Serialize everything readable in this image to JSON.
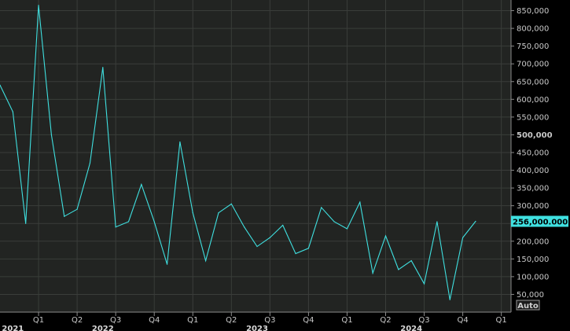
{
  "chart_data": {
    "type": "line",
    "x_unit": "month",
    "x": [
      "2021-10",
      "2021-11",
      "2021-12",
      "2022-01",
      "2022-02",
      "2022-03",
      "2022-04",
      "2022-05",
      "2022-06",
      "2022-07",
      "2022-08",
      "2022-09",
      "2022-10",
      "2022-11",
      "2022-12",
      "2023-01",
      "2023-02",
      "2023-03",
      "2023-04",
      "2023-05",
      "2023-06",
      "2023-07",
      "2023-08",
      "2023-09",
      "2023-10",
      "2023-11",
      "2023-12",
      "2024-01",
      "2024-02",
      "2024-03",
      "2024-04",
      "2024-05",
      "2024-06",
      "2024-07",
      "2024-08",
      "2024-09",
      "2024-10",
      "2024-11",
      "2024-12"
    ],
    "series": [
      {
        "color": "#3fe0e0",
        "values": [
          640000,
          565000,
          250000,
          865000,
          500000,
          270000,
          290000,
          420000,
          690000,
          240000,
          255000,
          360000,
          255000,
          135000,
          480000,
          280000,
          145000,
          280000,
          305000,
          240000,
          185000,
          210000,
          245000,
          165000,
          180000,
          295000,
          255000,
          235000,
          310000,
          110000,
          215000,
          120000,
          145000,
          80000,
          255000,
          35000,
          210000,
          256000
        ]
      }
    ],
    "ylim": [
      0,
      880000
    ],
    "yticks": [
      "50,000",
      "100,000",
      "150,000",
      "200,000",
      "250,000",
      "300,000",
      "350,000",
      "400,000",
      "450,000",
      "500,000",
      "550,000",
      "600,000",
      "650,000",
      "700,000",
      "750,000",
      "800,000",
      "850,000"
    ],
    "yticks_bold": [
      "500,000"
    ],
    "quarter_ticks": [
      {
        "label": "Q1",
        "date": "2022-01"
      },
      {
        "label": "Q2",
        "date": "2022-04"
      },
      {
        "label": "Q3",
        "date": "2022-07"
      },
      {
        "label": "Q4",
        "date": "2022-10"
      },
      {
        "label": "Q1",
        "date": "2023-01"
      },
      {
        "label": "Q2",
        "date": "2023-04"
      },
      {
        "label": "Q3",
        "date": "2023-07"
      },
      {
        "label": "Q4",
        "date": "2023-10"
      },
      {
        "label": "Q1",
        "date": "2024-01"
      },
      {
        "label": "Q2",
        "date": "2024-04"
      },
      {
        "label": "Q3",
        "date": "2024-07"
      },
      {
        "label": "Q4",
        "date": "2024-10"
      },
      {
        "label": "Q1",
        "date": "2025-01"
      }
    ],
    "year_labels": [
      {
        "label": "2021",
        "date": "2021-11"
      },
      {
        "label": "2022",
        "date": "2022-06"
      },
      {
        "label": "2023",
        "date": "2023-06"
      },
      {
        "label": "2024",
        "date": "2024-06"
      }
    ],
    "current_value": 256000,
    "current_value_label": "256,000.000",
    "grid": true,
    "background": "#222422",
    "gridline_color": "#3a3d3a",
    "accent_color": "#3fe0e0"
  },
  "controls": {
    "scale_mode_label": "Auto"
  }
}
